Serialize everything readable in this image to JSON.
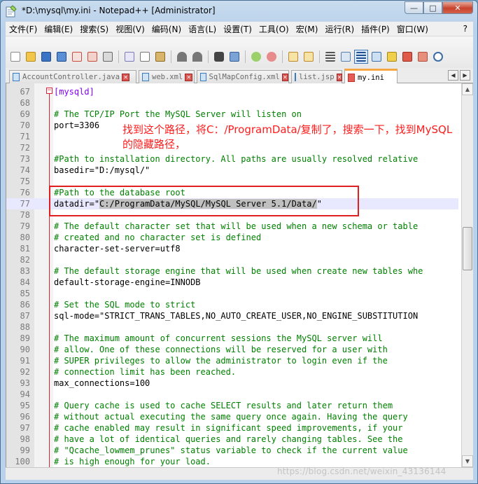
{
  "window": {
    "title": "*D:\\mysql\\my.ini - Notepad++ [Administrator]",
    "caption_minimize": "—",
    "caption_maximize": "□",
    "caption_close": "✕"
  },
  "menu": [
    "文件(F)",
    "编辑(E)",
    "搜索(S)",
    "视图(V)",
    "编码(N)",
    "语言(L)",
    "设置(T)",
    "工具(O)",
    "宏(M)",
    "运行(R)",
    "插件(P)",
    "窗口(W)",
    "?"
  ],
  "tabs": [
    {
      "label": "AccountController.java",
      "active": false
    },
    {
      "label": "web.xml",
      "active": false
    },
    {
      "label": "SqlMapConfig.xml",
      "active": false
    },
    {
      "label": "list.jsp",
      "active": false
    },
    {
      "label": "my.ini",
      "active": true
    }
  ],
  "lines": [
    {
      "n": "67",
      "parts": [
        [
          "section",
          "[mysqld]"
        ]
      ]
    },
    {
      "n": "68",
      "parts": []
    },
    {
      "n": "69",
      "parts": [
        [
          "comment",
          "# The TCP/IP Port the MySQL Server will listen on"
        ]
      ]
    },
    {
      "n": "70",
      "parts": [
        [
          "plain",
          "port"
        ],
        [
          "op",
          "="
        ],
        [
          "plain",
          "3306"
        ]
      ]
    },
    {
      "n": "71",
      "parts": []
    },
    {
      "n": "72",
      "parts": []
    },
    {
      "n": "73",
      "parts": [
        [
          "comment",
          "#Path to installation directory. All paths are usually resolved relative"
        ]
      ]
    },
    {
      "n": "74",
      "parts": [
        [
          "plain",
          "basedir"
        ],
        [
          "op",
          "="
        ],
        [
          "plain",
          "\"D:/mysql/\""
        ]
      ]
    },
    {
      "n": "75",
      "parts": []
    },
    {
      "n": "76",
      "parts": [
        [
          "comment",
          "#Path to the database root"
        ]
      ]
    },
    {
      "n": "77",
      "parts": [
        [
          "plain",
          "datadir"
        ],
        [
          "op",
          "="
        ],
        [
          "plain",
          "\""
        ],
        [
          "sel",
          "C:/ProgramData/MySQL/MySQL Server 5.1/Data/"
        ],
        [
          "plain",
          "\""
        ]
      ],
      "current": true
    },
    {
      "n": "78",
      "parts": []
    },
    {
      "n": "79",
      "parts": [
        [
          "comment",
          "# The default character set that will be used when a new schema or table"
        ]
      ]
    },
    {
      "n": "80",
      "parts": [
        [
          "comment",
          "# created and no character set is defined"
        ]
      ]
    },
    {
      "n": "81",
      "parts": [
        [
          "plain",
          "character-set-server"
        ],
        [
          "op",
          "="
        ],
        [
          "plain",
          "utf8"
        ]
      ]
    },
    {
      "n": "82",
      "parts": []
    },
    {
      "n": "83",
      "parts": [
        [
          "comment",
          "# The default storage engine that will be used when create new tables whe"
        ]
      ]
    },
    {
      "n": "84",
      "parts": [
        [
          "plain",
          "default-storage-engine"
        ],
        [
          "op",
          "="
        ],
        [
          "plain",
          "INNODB"
        ]
      ]
    },
    {
      "n": "85",
      "parts": []
    },
    {
      "n": "86",
      "parts": [
        [
          "comment",
          "# Set the SQL mode to strict"
        ]
      ]
    },
    {
      "n": "87",
      "parts": [
        [
          "plain",
          "sql-mode"
        ],
        [
          "op",
          "="
        ],
        [
          "plain",
          "\"STRICT_TRANS_TABLES,NO_AUTO_CREATE_USER,NO_ENGINE_SUBSTITUTION"
        ]
      ]
    },
    {
      "n": "88",
      "parts": []
    },
    {
      "n": "89",
      "parts": [
        [
          "comment",
          "# The maximum amount of concurrent sessions the MySQL server will"
        ]
      ]
    },
    {
      "n": "90",
      "parts": [
        [
          "comment",
          "# allow. One of these connections will be reserved for a user with"
        ]
      ]
    },
    {
      "n": "91",
      "parts": [
        [
          "comment",
          "# SUPER privileges to allow the administrator to login even if the"
        ]
      ]
    },
    {
      "n": "92",
      "parts": [
        [
          "comment",
          "# connection limit has been reached."
        ]
      ]
    },
    {
      "n": "93",
      "parts": [
        [
          "plain",
          "max_connections"
        ],
        [
          "op",
          "="
        ],
        [
          "plain",
          "100"
        ]
      ]
    },
    {
      "n": "94",
      "parts": []
    },
    {
      "n": "95",
      "parts": [
        [
          "comment",
          "# Query cache is used to cache SELECT results and later return them"
        ]
      ]
    },
    {
      "n": "96",
      "parts": [
        [
          "comment",
          "# without actual executing the same query once again. Having the query"
        ]
      ]
    },
    {
      "n": "97",
      "parts": [
        [
          "comment",
          "# cache enabled may result in significant speed improvements, if your"
        ]
      ]
    },
    {
      "n": "98",
      "parts": [
        [
          "comment",
          "# have a lot of identical queries and rarely changing tables. See the"
        ]
      ]
    },
    {
      "n": "99",
      "parts": [
        [
          "comment",
          "# \"Qcache_lowmem_prunes\" status variable to check if the current value"
        ]
      ]
    },
    {
      "n": "100",
      "parts": [
        [
          "comment",
          "# is high enough for your load."
        ]
      ]
    }
  ],
  "annotation": {
    "text_line1": "找到这个路径，将C：/ProgramData/复制了，搜索一下，找到MySQL",
    "text_line2": "的隐藏路径，"
  },
  "watermark": "https://blog.csdn.net/weixin_43136144",
  "colors": {
    "comment": "#008000",
    "section": "#8000ff",
    "selection": "#c0c0c0",
    "annotation": "#ff1c1c",
    "active_tab_accent": "#f4a742"
  }
}
